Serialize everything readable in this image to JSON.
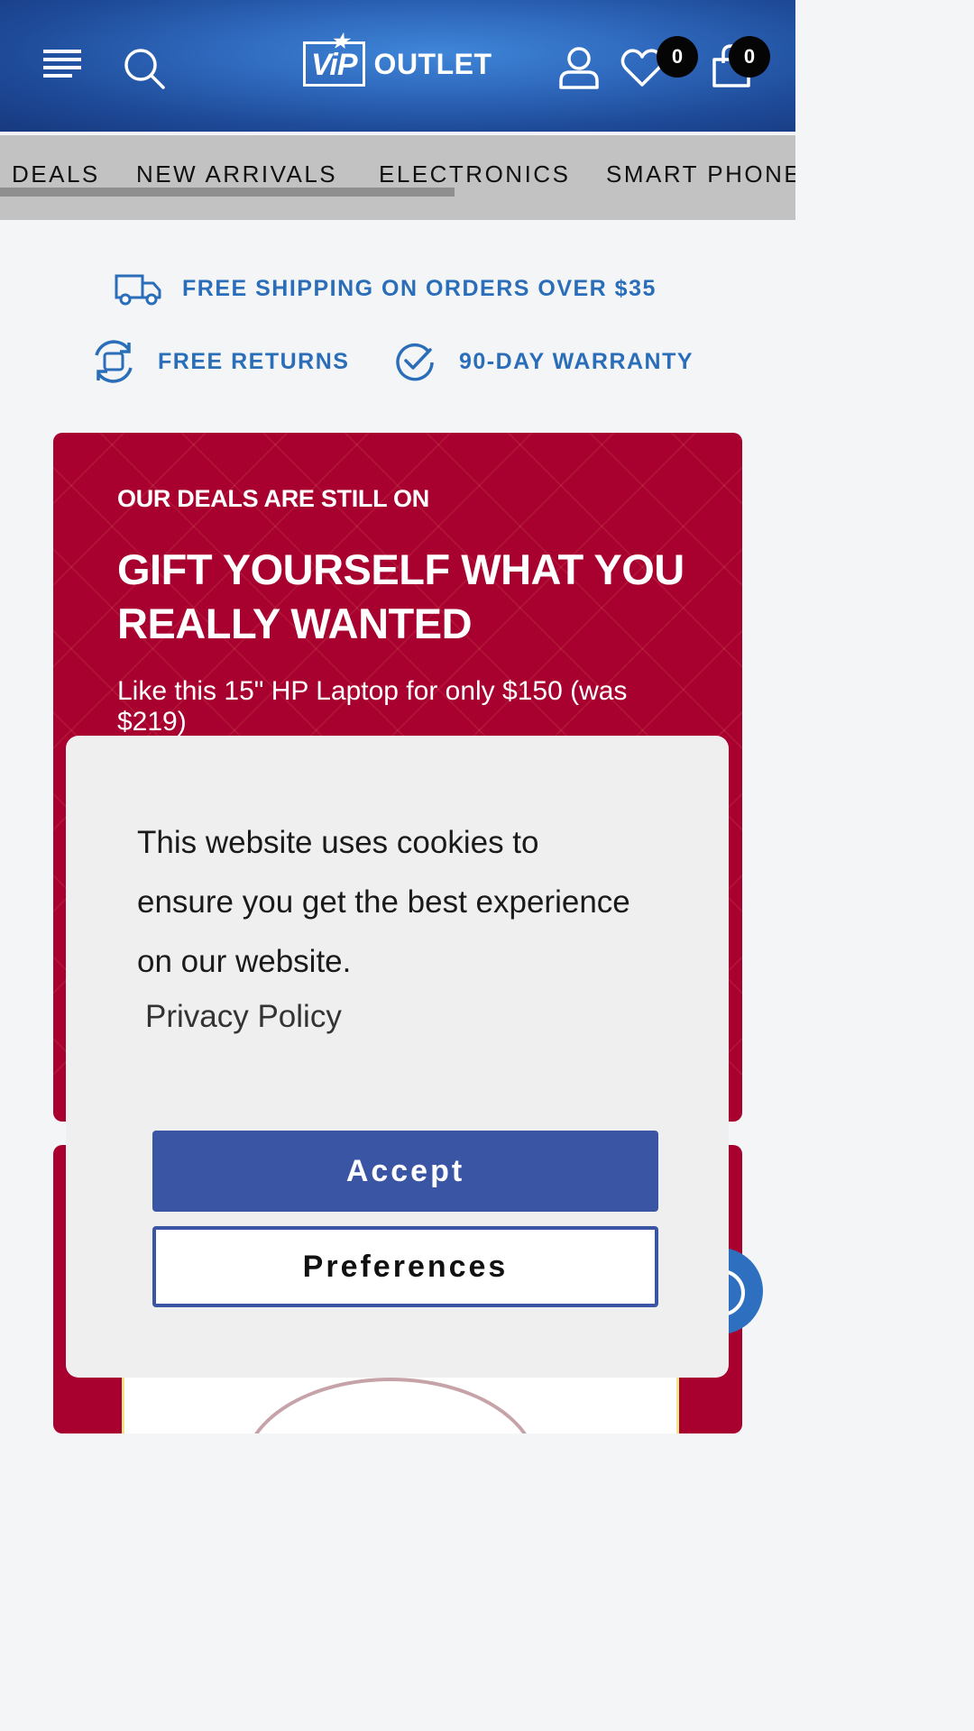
{
  "header": {
    "logo_mark": "ViP",
    "logo_text": "OUTLET",
    "wishlist_count": "0",
    "cart_count": "0",
    "icons": [
      "menu-icon",
      "search-icon",
      "account-icon",
      "heart-icon",
      "shopping-bag-icon"
    ]
  },
  "nav": {
    "items": [
      "DEALS",
      "NEW ARRIVALS",
      "ELECTRONICS",
      "SMART PHONE"
    ]
  },
  "perks": {
    "shipping": "FREE SHIPPING ON ORDERS OVER $35",
    "returns": "FREE RETURNS",
    "warranty": "90-DAY WARRANTY"
  },
  "promo": {
    "kicker": "OUR DEALS ARE STILL ON",
    "headline": "GIFT YOURSELF WHAT YOU REALLY WANTED",
    "subtext": "Like this 15\" HP Laptop for only $150 (was $219)"
  },
  "cookie_banner": {
    "message": "This website uses cookies to ensure you get the best experience on our website.",
    "policy_link": "Privacy Policy",
    "accept_label": "Accept",
    "preferences_label": "Preferences"
  },
  "colors": {
    "brand_blue": "#2f69bd",
    "perk_blue": "#2a6db8",
    "promo_red": "#a8002f",
    "accept_button": "#3b55a5"
  }
}
